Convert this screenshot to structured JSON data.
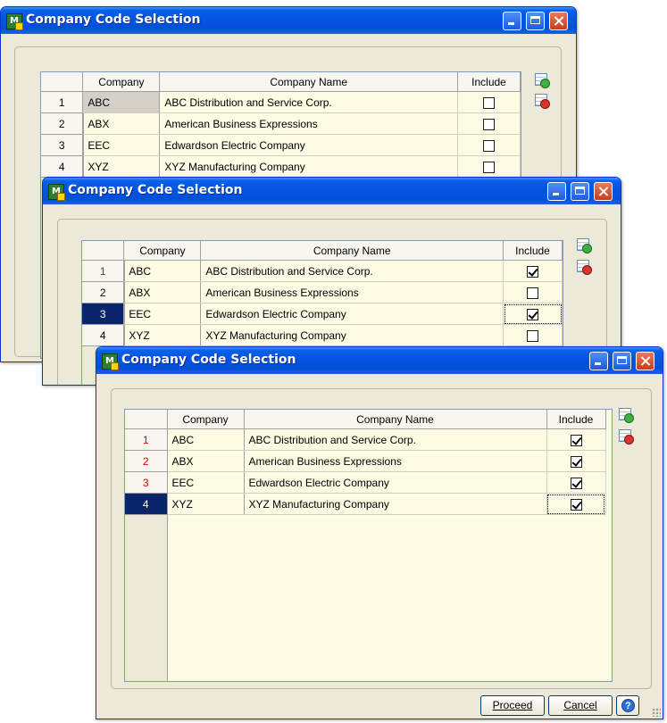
{
  "window_title": "Company Code Selection",
  "columns": {
    "company": "Company",
    "name": "Company Name",
    "include": "Include"
  },
  "rows": [
    {
      "num": "1",
      "code": "ABC",
      "name": "ABC Distribution and Service Corp."
    },
    {
      "num": "2",
      "code": "ABX",
      "name": "American Business Expressions"
    },
    {
      "num": "3",
      "code": "EEC",
      "name": "Edwardson Electric Company"
    },
    {
      "num": "4",
      "code": "XYZ",
      "name": "XYZ Manufacturing Company"
    }
  ],
  "windows": [
    {
      "checked": [
        false,
        false,
        false,
        false
      ]
    },
    {
      "checked": [
        true,
        false,
        true,
        false
      ]
    },
    {
      "checked": [
        true,
        true,
        true,
        true
      ]
    }
  ],
  "buttons": {
    "proceed": "Proceed",
    "cancel": "Cancel",
    "help": "?"
  },
  "side_icons": [
    "check-all-icon",
    "uncheck-all-icon"
  ],
  "colors": {
    "title_bar": "#0454e2",
    "selected_row": "#0a246a",
    "marked_row_number": "#e00000",
    "grid_background": "#fdfbe3"
  }
}
